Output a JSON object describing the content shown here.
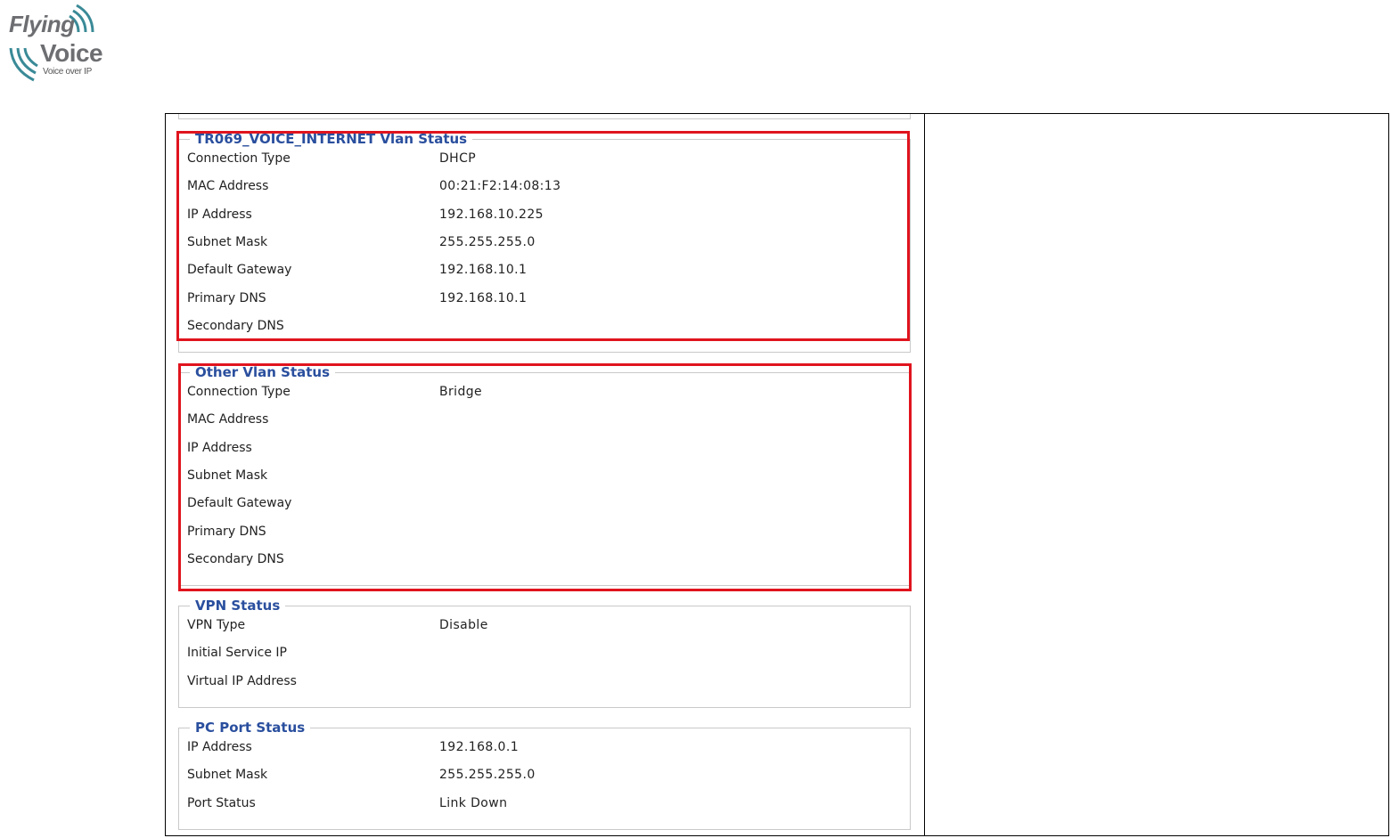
{
  "logo": {
    "word1": "Flying",
    "word2": "Voice",
    "tagline": "Voice over IP"
  },
  "colors": {
    "legend": "#2a4f9e",
    "highlight": "#e0141e",
    "panel_border": "#c9c9c9"
  },
  "sections": [
    {
      "title": "TR069_VOICE_INTERNET Vlan Status",
      "rows": [
        {
          "label": "Connection Type",
          "value": "DHCP"
        },
        {
          "label": "MAC Address",
          "value": "00:21:F2:14:08:13"
        },
        {
          "label": "IP Address",
          "value": "192.168.10.225"
        },
        {
          "label": "Subnet Mask",
          "value": "255.255.255.0"
        },
        {
          "label": "Default Gateway",
          "value": "192.168.10.1"
        },
        {
          "label": "Primary DNS",
          "value": "192.168.10.1"
        },
        {
          "label": "Secondary DNS",
          "value": ""
        }
      ]
    },
    {
      "title": "Other Vlan Status",
      "rows": [
        {
          "label": "Connection Type",
          "value": "Bridge"
        },
        {
          "label": "MAC Address",
          "value": ""
        },
        {
          "label": "IP Address",
          "value": ""
        },
        {
          "label": "Subnet Mask",
          "value": ""
        },
        {
          "label": "Default Gateway",
          "value": ""
        },
        {
          "label": "Primary DNS",
          "value": ""
        },
        {
          "label": "Secondary DNS",
          "value": ""
        }
      ]
    },
    {
      "title": "VPN Status",
      "rows": [
        {
          "label": "VPN Type",
          "value": "Disable"
        },
        {
          "label": "Initial Service IP",
          "value": ""
        },
        {
          "label": "Virtual IP Address",
          "value": ""
        }
      ]
    },
    {
      "title": "PC Port Status",
      "rows": [
        {
          "label": "IP Address",
          "value": "192.168.0.1"
        },
        {
          "label": "Subnet Mask",
          "value": "255.255.255.0"
        },
        {
          "label": "Port Status",
          "value": "Link Down"
        }
      ]
    }
  ]
}
